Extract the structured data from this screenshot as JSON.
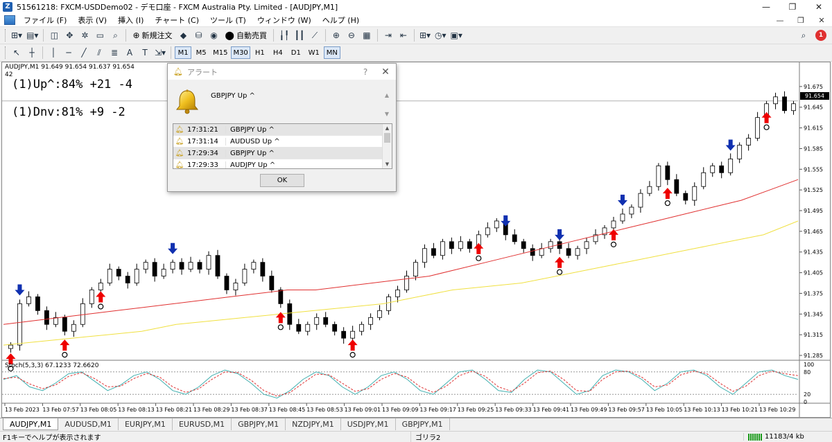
{
  "window": {
    "title": "51561218: FXCM-USDDemo02 - デモ口座 - FXCM Australia Pty. Limited - [AUDJPY,M1]",
    "minimize": "—",
    "maximize": "❐",
    "close": "✕"
  },
  "menu": {
    "items": [
      "ファイル (F)",
      "表示 (V)",
      "挿入 (I)",
      "チャート (C)",
      "ツール (T)",
      "ウィンドウ (W)",
      "ヘルプ (H)"
    ],
    "mdi_min": "—",
    "mdi_restore": "❐",
    "mdi_close": "✕"
  },
  "toolbar": {
    "new_order_label": "新規注文",
    "auto_trade_label": "自動売買",
    "notification_count": "1",
    "timeframes": [
      "M1",
      "M5",
      "M15",
      "M30",
      "H1",
      "H4",
      "D1",
      "W1",
      "MN"
    ],
    "active_timeframes": [
      "M1",
      "M30",
      "MN"
    ]
  },
  "chart": {
    "header": "AUDJPY,M1  91.649 91.654 91.637 91.654",
    "sub_header": "42",
    "label_up": "(1)Up^:84% +21 -4",
    "label_dn": "(1)Dnv:81% +9 -2",
    "stoch_label": "Stoch(5,3,3) 67.1233 72.6620",
    "current_price": "91.654",
    "colors": {
      "bull_candle": "#ffffff",
      "bear_candle": "#000000",
      "ma_fast": "#e03030",
      "ma_slow": "#f0e040",
      "up_arrow": "#ee0000",
      "down_arrow": "#1030b0",
      "stoch_main": "#40b0b0",
      "stoch_signal": "#e03030"
    }
  },
  "chart_data": {
    "type": "candlestick",
    "symbol": "AUDJPY",
    "timeframe": "M1",
    "ylim": [
      91.28,
      91.7
    ],
    "y_ticks": [
      "91.675",
      "91.645",
      "91.615",
      "91.585",
      "91.555",
      "91.525",
      "91.495",
      "91.465",
      "91.435",
      "91.405",
      "91.375",
      "91.345",
      "91.315",
      "91.285"
    ],
    "x_ticks": [
      "13 Feb 2023",
      "13 Feb 07:57",
      "13 Feb 08:05",
      "13 Feb 08:13",
      "13 Feb 08:21",
      "13 Feb 08:29",
      "13 Feb 08:37",
      "13 Feb 08:45",
      "13 Feb 08:53",
      "13 Feb 09:01",
      "13 Feb 09:09",
      "13 Feb 09:17",
      "13 Feb 09:25",
      "13 Feb 09:33",
      "13 Feb 09:41",
      "13 Feb 09:49",
      "13 Feb 09:57",
      "13 Feb 10:05",
      "13 Feb 10:13",
      "13 Feb 10:21",
      "13 Feb 10:29"
    ],
    "close": [
      91.3,
      91.36,
      91.37,
      91.35,
      91.33,
      91.34,
      91.32,
      91.33,
      91.36,
      91.38,
      91.39,
      91.41,
      91.4,
      91.39,
      91.41,
      91.42,
      91.4,
      91.41,
      91.42,
      91.41,
      91.42,
      91.41,
      91.43,
      91.4,
      91.38,
      91.39,
      91.41,
      91.42,
      91.4,
      91.38,
      91.36,
      91.33,
      91.32,
      91.33,
      91.34,
      91.33,
      91.32,
      91.31,
      91.32,
      91.33,
      91.34,
      91.35,
      91.37,
      91.38,
      91.4,
      91.42,
      91.44,
      91.43,
      91.45,
      91.44,
      91.45,
      91.44,
      91.46,
      91.47,
      91.48,
      91.46,
      91.45,
      91.44,
      91.43,
      91.44,
      91.45,
      91.44,
      91.43,
      91.44,
      91.45,
      91.46,
      91.47,
      91.48,
      91.49,
      91.5,
      91.52,
      91.53,
      91.56,
      91.54,
      91.52,
      91.51,
      91.53,
      91.55,
      91.56,
      91.55,
      91.57,
      91.59,
      91.6,
      91.63,
      91.65,
      91.66,
      91.64,
      91.65
    ],
    "series": [
      {
        "name": "MA fast",
        "values": [
          91.33,
          91.335,
          91.34,
          91.345,
          91.35,
          91.355,
          91.36,
          91.365,
          91.37,
          91.375,
          91.38,
          91.38,
          91.385,
          91.39,
          91.395,
          91.4,
          91.41,
          91.42,
          91.43,
          91.44,
          91.45,
          91.46,
          91.47,
          91.48,
          91.49,
          91.5,
          91.51,
          91.525,
          91.54
        ]
      },
      {
        "name": "MA slow",
        "values": [
          91.3,
          91.305,
          91.31,
          91.315,
          91.32,
          91.33,
          91.335,
          91.34,
          91.345,
          91.35,
          91.355,
          91.36,
          91.37,
          91.38,
          91.385,
          91.39,
          91.4,
          91.41,
          91.42,
          91.43,
          91.44,
          91.45,
          91.46,
          91.48
        ]
      }
    ],
    "up_arrows_at": [
      0,
      6,
      10,
      30,
      38,
      52,
      61,
      67,
      73,
      84,
      94
    ],
    "down_arrows_at": [
      1,
      18,
      55,
      61,
      68,
      80,
      93
    ],
    "stoch_levels": [
      "100",
      "80",
      "20",
      "0"
    ],
    "stoch_main": [
      60,
      70,
      40,
      30,
      50,
      75,
      80,
      55,
      30,
      45,
      70,
      80,
      60,
      30,
      20,
      40,
      70,
      85,
      75,
      50,
      20,
      10,
      30,
      60,
      80,
      70,
      40,
      20,
      40,
      70,
      80,
      60,
      30,
      20,
      50,
      80,
      85,
      60,
      30,
      25,
      60,
      85,
      80,
      50,
      20,
      30,
      70,
      85,
      80,
      60,
      30,
      50,
      80,
      85,
      70,
      40,
      20,
      50,
      80,
      85,
      70,
      60
    ],
    "stoch_signal": [
      62,
      66,
      48,
      35,
      45,
      68,
      78,
      62,
      40,
      42,
      62,
      76,
      66,
      40,
      25,
      35,
      60,
      80,
      78,
      58,
      30,
      15,
      25,
      50,
      74,
      72,
      50,
      28,
      35,
      60,
      76,
      66,
      40,
      25,
      42,
      70,
      82,
      68,
      40,
      28,
      50,
      78,
      82,
      60,
      30,
      28,
      60,
      80,
      82,
      66,
      40,
      45,
      72,
      82,
      75,
      50,
      28,
      42,
      70,
      82,
      75,
      70
    ]
  },
  "tabs": [
    "AUDJPY,M1",
    "AUDUSD,M1",
    "EURJPY,M1",
    "EURUSD,M1",
    "GBPJPY,M1",
    "NZDJPY,M1",
    "USDJPY,M1",
    "GBPJPY,M1"
  ],
  "status": {
    "help_text": "F1キーでヘルプが表示されます",
    "profile": "ゴリラ2",
    "traffic": "11183/4 kb"
  },
  "alert": {
    "title": "アラート",
    "help": "?",
    "close": "✕",
    "message": "GBPJPY Up ^",
    "rows": [
      {
        "time": "17:31:21",
        "message": "GBPJPY Up ^"
      },
      {
        "time": "17:31:14",
        "message": "AUDUSD Up ^"
      },
      {
        "time": "17:29:34",
        "message": "GBPJPY Up ^"
      },
      {
        "time": "17:29:33",
        "message": "AUDJPY Up ^"
      }
    ],
    "ok_label": "OK"
  }
}
